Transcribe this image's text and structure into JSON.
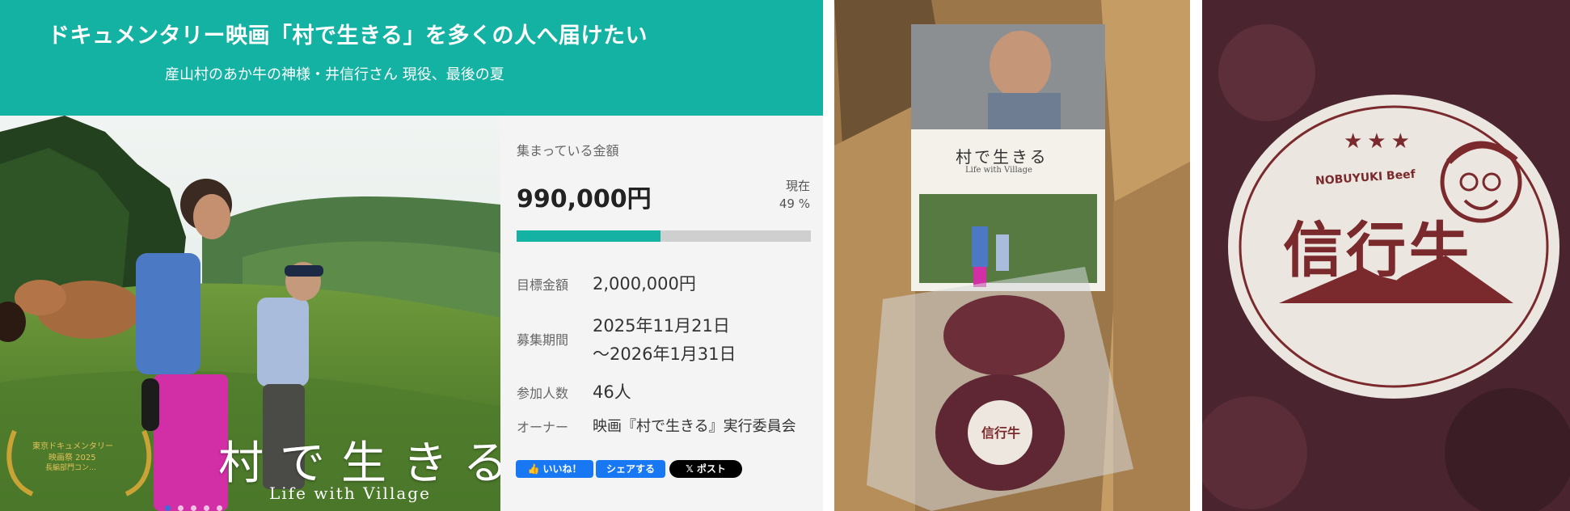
{
  "header": {
    "title": "ドキュメンタリー映画「村で生きる」を多くの人へ届けたい",
    "subtitle": "産山村のあか牛の神様・井信行さん 現役、最後の夏"
  },
  "hero": {
    "film_title": "村で生きる",
    "film_subtitle": "Life with Village",
    "award_line1": "東京ドキュメンタリー",
    "award_line2": "映画祭 2025",
    "award_line3": "長編部門コン…",
    "slides": 5,
    "active_slide": 1
  },
  "stats": {
    "raised_label": "集まっている金額",
    "raised_amount": "990,000円",
    "current_label": "現在",
    "percent_text": "49 %",
    "progress": 0.49,
    "goal_label": "目標金額",
    "goal_value": "2,000,000円",
    "period_label": "募集期間",
    "period_start": "2025年11月21日",
    "period_end": "～2026年1月31日",
    "participants_label": "参加人数",
    "participants_value": "46人",
    "owner_label": "オーナー",
    "owner_value": "映画『村で生きる』実行委員会"
  },
  "social": {
    "like_label": "👍 いいね！",
    "share_label": "シェアする",
    "post_label": "𝕏 ポスト"
  },
  "photo_box": {
    "pamphlet_title": "村で生きる",
    "pamphlet_subtitle": "Life with Village",
    "sticker_text": "信行牛"
  },
  "photo_beef": {
    "brand": "NOBUYUKI Beef",
    "label": "信行牛",
    "stars": "★★★"
  },
  "colors": {
    "accent": "#14b2a2",
    "facebook": "#1877f2",
    "x": "#000000",
    "beef_ink": "#7a2a2c"
  }
}
